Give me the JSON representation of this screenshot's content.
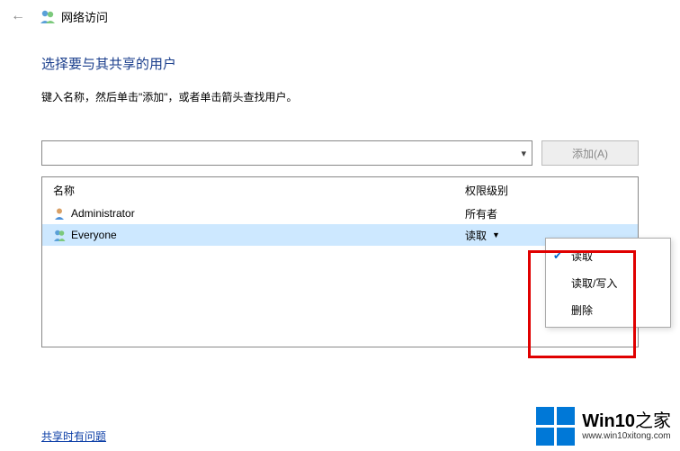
{
  "window": {
    "title": "网络访问",
    "back_icon": "←"
  },
  "content": {
    "heading": "选择要与其共享的用户",
    "instruction": "键入名称，然后单击\"添加\"，或者单击箭头查找用户。"
  },
  "input": {
    "value": "",
    "add_button": "添加(A)"
  },
  "table": {
    "columns": {
      "name": "名称",
      "permission": "权限级别"
    },
    "rows": [
      {
        "name": "Administrator",
        "permission": "所有者",
        "selected": false,
        "type": "user"
      },
      {
        "name": "Everyone",
        "permission": "读取",
        "selected": true,
        "type": "group"
      }
    ]
  },
  "perm_menu": {
    "items": [
      {
        "label": "读取",
        "checked": true
      },
      {
        "label": "读取/写入",
        "checked": false
      },
      {
        "label": "删除",
        "checked": false
      }
    ]
  },
  "help_link": "共享时有问题",
  "watermark": {
    "brand_bold": "Win10",
    "brand_light": "之家",
    "url": "www.win10xitong.com"
  }
}
